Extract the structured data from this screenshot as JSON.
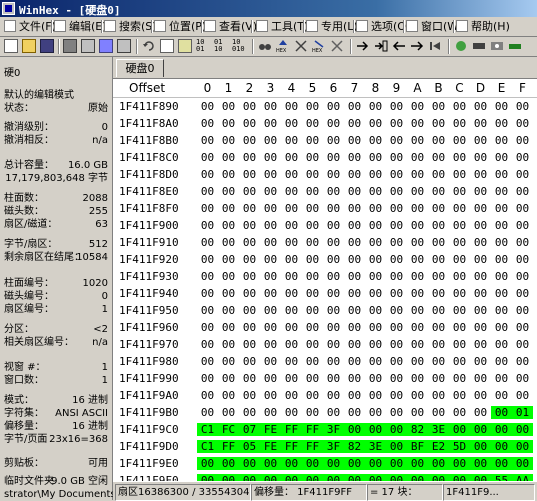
{
  "window": {
    "title": "WinHex - [硬盘0]"
  },
  "menu": [
    {
      "label": "文件(F)",
      "icon": "file-icon"
    },
    {
      "label": "编辑(E)",
      "icon": "edit-icon"
    },
    {
      "label": "搜索(S)",
      "icon": "search-icon"
    },
    {
      "label": "位置(P)",
      "icon": "position-icon"
    },
    {
      "label": "查看(V)",
      "icon": "view-icon"
    },
    {
      "label": "工具(T)",
      "icon": "tools-icon"
    },
    {
      "label": "专用(L)",
      "icon": "specialist-icon"
    },
    {
      "label": "选项(O)",
      "icon": "options-icon"
    },
    {
      "label": "窗口(W)",
      "icon": "window-icon"
    },
    {
      "label": "帮助(H)",
      "icon": "help-icon"
    }
  ],
  "tab": {
    "label": "硬盘0"
  },
  "info": {
    "device": "硬0",
    "rows": [
      {
        "k": "默认的编辑模式",
        "v": ""
      },
      {
        "k": "状态：",
        "v": "原始"
      },
      {
        "k": "撤消级别：",
        "v": "0"
      },
      {
        "k": "撤消相反：",
        "v": "n/a"
      },
      {
        "k": "总计容量：",
        "v": "16.0 GB"
      },
      {
        "k": "",
        "v": "17,179,803,648 字节"
      },
      {
        "k": "柱面数：",
        "v": "2088"
      },
      {
        "k": "磁头数：",
        "v": "255"
      },
      {
        "k": "扇区/磁道：",
        "v": "63"
      },
      {
        "k": "字节/扇区：",
        "v": "512"
      },
      {
        "k": "剩余扇区在结尾：",
        "v": "10584"
      },
      {
        "k": "柱面编号：",
        "v": "1020"
      },
      {
        "k": "磁头编号：",
        "v": "0"
      },
      {
        "k": "扇区编号：",
        "v": "1"
      },
      {
        "k": "分区：",
        "v": "<2"
      },
      {
        "k": "相关扇区编号：",
        "v": "n/a"
      },
      {
        "k": "视窗 #：",
        "v": "1"
      },
      {
        "k": "窗口数：",
        "v": "1"
      },
      {
        "k": "模式：",
        "v": "16 进制"
      },
      {
        "k": "字符集：",
        "v": "ANSI ASCII"
      },
      {
        "k": "偏移量：",
        "v": "16 进制"
      },
      {
        "k": "字节/页面",
        "v": "23x16=368"
      },
      {
        "k": "剪贴板：",
        "v": "可用"
      },
      {
        "k": "临时文件夹",
        "v": "9.0 GB 空闲"
      },
      {
        "k": "strator\\My Documents",
        "v": ""
      }
    ]
  },
  "hex": {
    "offset_label": "Offset",
    "columns": [
      "0",
      "1",
      "2",
      "3",
      "4",
      "5",
      "6",
      "7",
      "8",
      "9",
      "A",
      "B",
      "C",
      "D",
      "E",
      "F"
    ],
    "rows": [
      {
        "addr": "1F411F890",
        "bytes": [
          "00",
          "00",
          "00",
          "00",
          "00",
          "00",
          "00",
          "00",
          "00",
          "00",
          "00",
          "00",
          "00",
          "00",
          "00",
          "00"
        ]
      },
      {
        "addr": "1F411F8A0",
        "bytes": [
          "00",
          "00",
          "00",
          "00",
          "00",
          "00",
          "00",
          "00",
          "00",
          "00",
          "00",
          "00",
          "00",
          "00",
          "00",
          "00"
        ]
      },
      {
        "addr": "1F411F8B0",
        "bytes": [
          "00",
          "00",
          "00",
          "00",
          "00",
          "00",
          "00",
          "00",
          "00",
          "00",
          "00",
          "00",
          "00",
          "00",
          "00",
          "00"
        ]
      },
      {
        "addr": "1F411F8C0",
        "bytes": [
          "00",
          "00",
          "00",
          "00",
          "00",
          "00",
          "00",
          "00",
          "00",
          "00",
          "00",
          "00",
          "00",
          "00",
          "00",
          "00"
        ]
      },
      {
        "addr": "1F411F8D0",
        "bytes": [
          "00",
          "00",
          "00",
          "00",
          "00",
          "00",
          "00",
          "00",
          "00",
          "00",
          "00",
          "00",
          "00",
          "00",
          "00",
          "00"
        ]
      },
      {
        "addr": "1F411F8E0",
        "bytes": [
          "00",
          "00",
          "00",
          "00",
          "00",
          "00",
          "00",
          "00",
          "00",
          "00",
          "00",
          "00",
          "00",
          "00",
          "00",
          "00"
        ]
      },
      {
        "addr": "1F411F8F0",
        "bytes": [
          "00",
          "00",
          "00",
          "00",
          "00",
          "00",
          "00",
          "00",
          "00",
          "00",
          "00",
          "00",
          "00",
          "00",
          "00",
          "00"
        ]
      },
      {
        "addr": "1F411F900",
        "bytes": [
          "00",
          "00",
          "00",
          "00",
          "00",
          "00",
          "00",
          "00",
          "00",
          "00",
          "00",
          "00",
          "00",
          "00",
          "00",
          "00"
        ]
      },
      {
        "addr": "1F411F910",
        "bytes": [
          "00",
          "00",
          "00",
          "00",
          "00",
          "00",
          "00",
          "00",
          "00",
          "00",
          "00",
          "00",
          "00",
          "00",
          "00",
          "00"
        ]
      },
      {
        "addr": "1F411F920",
        "bytes": [
          "00",
          "00",
          "00",
          "00",
          "00",
          "00",
          "00",
          "00",
          "00",
          "00",
          "00",
          "00",
          "00",
          "00",
          "00",
          "00"
        ]
      },
      {
        "addr": "1F411F930",
        "bytes": [
          "00",
          "00",
          "00",
          "00",
          "00",
          "00",
          "00",
          "00",
          "00",
          "00",
          "00",
          "00",
          "00",
          "00",
          "00",
          "00"
        ]
      },
      {
        "addr": "1F411F940",
        "bytes": [
          "00",
          "00",
          "00",
          "00",
          "00",
          "00",
          "00",
          "00",
          "00",
          "00",
          "00",
          "00",
          "00",
          "00",
          "00",
          "00"
        ]
      },
      {
        "addr": "1F411F950",
        "bytes": [
          "00",
          "00",
          "00",
          "00",
          "00",
          "00",
          "00",
          "00",
          "00",
          "00",
          "00",
          "00",
          "00",
          "00",
          "00",
          "00"
        ]
      },
      {
        "addr": "1F411F960",
        "bytes": [
          "00",
          "00",
          "00",
          "00",
          "00",
          "00",
          "00",
          "00",
          "00",
          "00",
          "00",
          "00",
          "00",
          "00",
          "00",
          "00"
        ]
      },
      {
        "addr": "1F411F970",
        "bytes": [
          "00",
          "00",
          "00",
          "00",
          "00",
          "00",
          "00",
          "00",
          "00",
          "00",
          "00",
          "00",
          "00",
          "00",
          "00",
          "00"
        ]
      },
      {
        "addr": "1F411F980",
        "bytes": [
          "00",
          "00",
          "00",
          "00",
          "00",
          "00",
          "00",
          "00",
          "00",
          "00",
          "00",
          "00",
          "00",
          "00",
          "00",
          "00"
        ]
      },
      {
        "addr": "1F411F990",
        "bytes": [
          "00",
          "00",
          "00",
          "00",
          "00",
          "00",
          "00",
          "00",
          "00",
          "00",
          "00",
          "00",
          "00",
          "00",
          "00",
          "00"
        ]
      },
      {
        "addr": "1F411F9A0",
        "bytes": [
          "00",
          "00",
          "00",
          "00",
          "00",
          "00",
          "00",
          "00",
          "00",
          "00",
          "00",
          "00",
          "00",
          "00",
          "00",
          "00"
        ]
      },
      {
        "addr": "1F411F9B0",
        "bytes": [
          "00",
          "00",
          "00",
          "00",
          "00",
          "00",
          "00",
          "00",
          "00",
          "00",
          "00",
          "00",
          "00",
          "00",
          "00",
          "01"
        ],
        "sel_from": 14
      },
      {
        "addr": "1F411F9C0",
        "bytes": [
          "C1",
          "FC",
          "07",
          "FE",
          "FF",
          "FF",
          "3F",
          "00",
          "00",
          "00",
          "82",
          "3E",
          "00",
          "00",
          "00",
          "00"
        ],
        "sel_from": 0
      },
      {
        "addr": "1F411F9D0",
        "bytes": [
          "C1",
          "FF",
          "05",
          "FE",
          "FF",
          "FF",
          "3F",
          "82",
          "3E",
          "00",
          "BF",
          "E2",
          "5D",
          "00",
          "00",
          "00"
        ],
        "sel_from": 0
      },
      {
        "addr": "1F411F9E0",
        "bytes": [
          "00",
          "00",
          "00",
          "00",
          "00",
          "00",
          "00",
          "00",
          "00",
          "00",
          "00",
          "00",
          "00",
          "00",
          "00",
          "00"
        ],
        "sel_from": 0
      },
      {
        "addr": "1F411F9F0",
        "bytes": [
          "00",
          "00",
          "00",
          "00",
          "00",
          "00",
          "00",
          "00",
          "00",
          "00",
          "00",
          "00",
          "00",
          "00",
          "55",
          "AA"
        ],
        "sel_from": 0
      }
    ]
  },
  "status": {
    "sector": "扇区16386300 / 33554304",
    "offset": "偏移量： 1F411F9FF",
    "value": "= 17 块：",
    "extra": "1F411F9..."
  },
  "colors": {
    "selection": "#00ff00",
    "title_start": "#0a246a",
    "title_end": "#a6caf0"
  }
}
